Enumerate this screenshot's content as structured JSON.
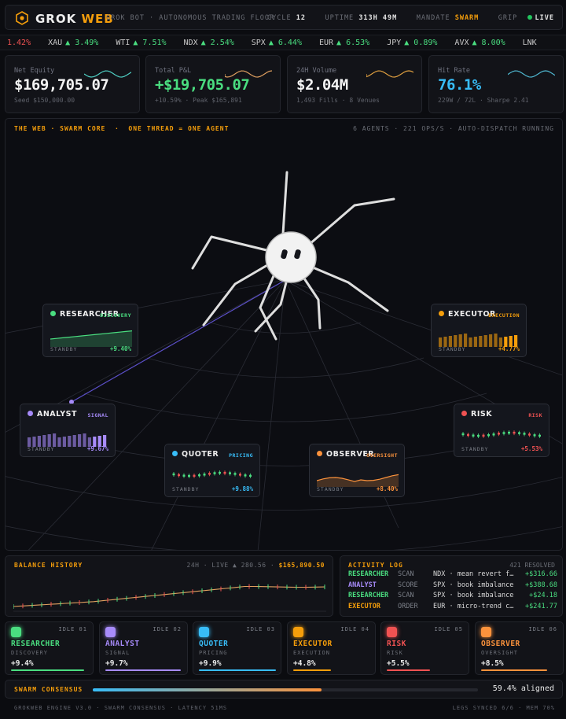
{
  "header": {
    "brand_a": "GROK",
    "brand_b": "WEB",
    "subtitle": "GROK BOT · AUTONOMOUS TRADING FLOOR",
    "cycle_label": "CYCLE",
    "cycle": "12",
    "uptime_label": "UPTIME",
    "uptime": "313H 49M",
    "mandate_label": "MANDATE",
    "mandate": "SWARM",
    "grip_label": "GRIP",
    "live": "LIVE"
  },
  "ticker": [
    {
      "sym": "",
      "chg": "1.42%",
      "up": false
    },
    {
      "sym": "XAU",
      "chg": "▲ 3.49%",
      "up": true
    },
    {
      "sym": "WTI",
      "chg": "▲ 7.51%",
      "up": true
    },
    {
      "sym": "NDX",
      "chg": "▲ 2.54%",
      "up": true
    },
    {
      "sym": "SPX",
      "chg": "▲ 6.44%",
      "up": true
    },
    {
      "sym": "EUR",
      "chg": "▲ 6.53%",
      "up": true
    },
    {
      "sym": "JPY",
      "chg": "▲ 0.89%",
      "up": true
    },
    {
      "sym": "AVX",
      "chg": "▲ 8.00%",
      "up": true
    },
    {
      "sym": "LNK",
      "chg": "",
      "up": true
    }
  ],
  "kpis": [
    {
      "label": "Net Equity",
      "value": "$169,705.07",
      "foot": "Seed $150,000.00",
      "color": "#f3f3f3",
      "spark": "#4fd1c5"
    },
    {
      "label": "Total P&L",
      "value": "+$19,705.07",
      "foot": "+10.59% · Peak $165,891",
      "color": "#4ade80",
      "spark": "#e0a060"
    },
    {
      "label": "24H Volume",
      "value": "$2.04M",
      "foot": "1,493 Fills · 8 Venues",
      "color": "#f3f3f3",
      "spark": "#e0a040"
    },
    {
      "label": "Hit Rate",
      "value": "76.1%",
      "foot": "229W / 72L · Sharpe 2.41",
      "color": "#38bdf8",
      "spark": "#4fb8d1"
    }
  ],
  "web": {
    "title": "THE WEB · SWARM CORE",
    "title2": "ONE THREAD = ONE AGENT",
    "stats": "6 AGENTS · 221 OPS/S · AUTO-DISPATCH RUNNING"
  },
  "agents": [
    {
      "name": "RESEARCHER",
      "tag": "DISCOVERY",
      "status": "STANDBY",
      "pct": "+9.40%",
      "color": "#4ade80",
      "kind": "area"
    },
    {
      "name": "EXECUTOR",
      "tag": "EXECUTION",
      "status": "STANDBY",
      "pct": "+4.77%",
      "color": "#f59e0b",
      "kind": "bars"
    },
    {
      "name": "ANALYST",
      "tag": "SIGNAL",
      "status": "STANDBY",
      "pct": "+9.67%",
      "color": "#a78bfa",
      "kind": "bars"
    },
    {
      "name": "RISK",
      "tag": "RISK",
      "status": "STANDBY",
      "pct": "+5.53%",
      "color": "#f05252",
      "kind": "candles"
    },
    {
      "name": "QUOTER",
      "tag": "PRICING",
      "status": "STANDBY",
      "pct": "+9.88%",
      "color": "#38bdf8",
      "kind": "candles"
    },
    {
      "name": "OBSERVER",
      "tag": "OVERSIGHT",
      "status": "STANDBY",
      "pct": "+8.40%",
      "color": "#fb923c",
      "kind": "area"
    }
  ],
  "balance": {
    "title": "BALANCE HISTORY",
    "range": "24H · LIVE ▲ 280.56 ·",
    "current": "$165,890.50"
  },
  "activity": {
    "title": "ACTIVITY LOG",
    "resolved": "421 RESOLVED",
    "rows": [
      {
        "agent": "RESEARCHER",
        "kind": "SCAN",
        "text": "NDX · mean revert f…",
        "value": "+$316.66",
        "color": "#4ade80"
      },
      {
        "agent": "ANALYST",
        "kind": "SCORE",
        "text": "SPX · book imbalance",
        "value": "+$388.68",
        "color": "#a78bfa"
      },
      {
        "agent": "RESEARCHER",
        "kind": "SCAN",
        "text": "SPX · book imbalance",
        "value": "+$24.18",
        "color": "#4ade80"
      },
      {
        "agent": "EXECUTOR",
        "kind": "ORDER",
        "text": "EUR · micro-trend c…",
        "value": "+$241.77",
        "color": "#f59e0b"
      }
    ]
  },
  "cards": [
    {
      "name": "RESEARCHER",
      "role": "DISCOVERY",
      "idle": "IDLE 01",
      "pct": "+9.4%",
      "color": "#4ade80",
      "fill": 0.94
    },
    {
      "name": "ANALYST",
      "role": "SIGNAL",
      "idle": "IDLE 02",
      "pct": "+9.7%",
      "color": "#a78bfa",
      "fill": 0.97
    },
    {
      "name": "QUOTER",
      "role": "PRICING",
      "idle": "IDLE 03",
      "pct": "+9.9%",
      "color": "#38bdf8",
      "fill": 0.99
    },
    {
      "name": "EXECUTOR",
      "role": "EXECUTION",
      "idle": "IDLE 04",
      "pct": "+4.8%",
      "color": "#f59e0b",
      "fill": 0.48
    },
    {
      "name": "RISK",
      "role": "RISK",
      "idle": "IDLE 05",
      "pct": "+5.5%",
      "color": "#f05252",
      "fill": 0.55
    },
    {
      "name": "OBSERVER",
      "role": "OVERSIGHT",
      "idle": "IDLE 06",
      "pct": "+8.5%",
      "color": "#fb923c",
      "fill": 0.85
    }
  ],
  "consensus": {
    "title": "SWARM CONSENSUS",
    "value": "59.4% aligned",
    "fill": 0.594
  },
  "footer": {
    "left": "GROKWEB ENGINE V3.0 · SWARM CONSENSUS · LATENCY 51MS",
    "right": "LEGS SYNCED 6/6 · MEM 70%"
  }
}
